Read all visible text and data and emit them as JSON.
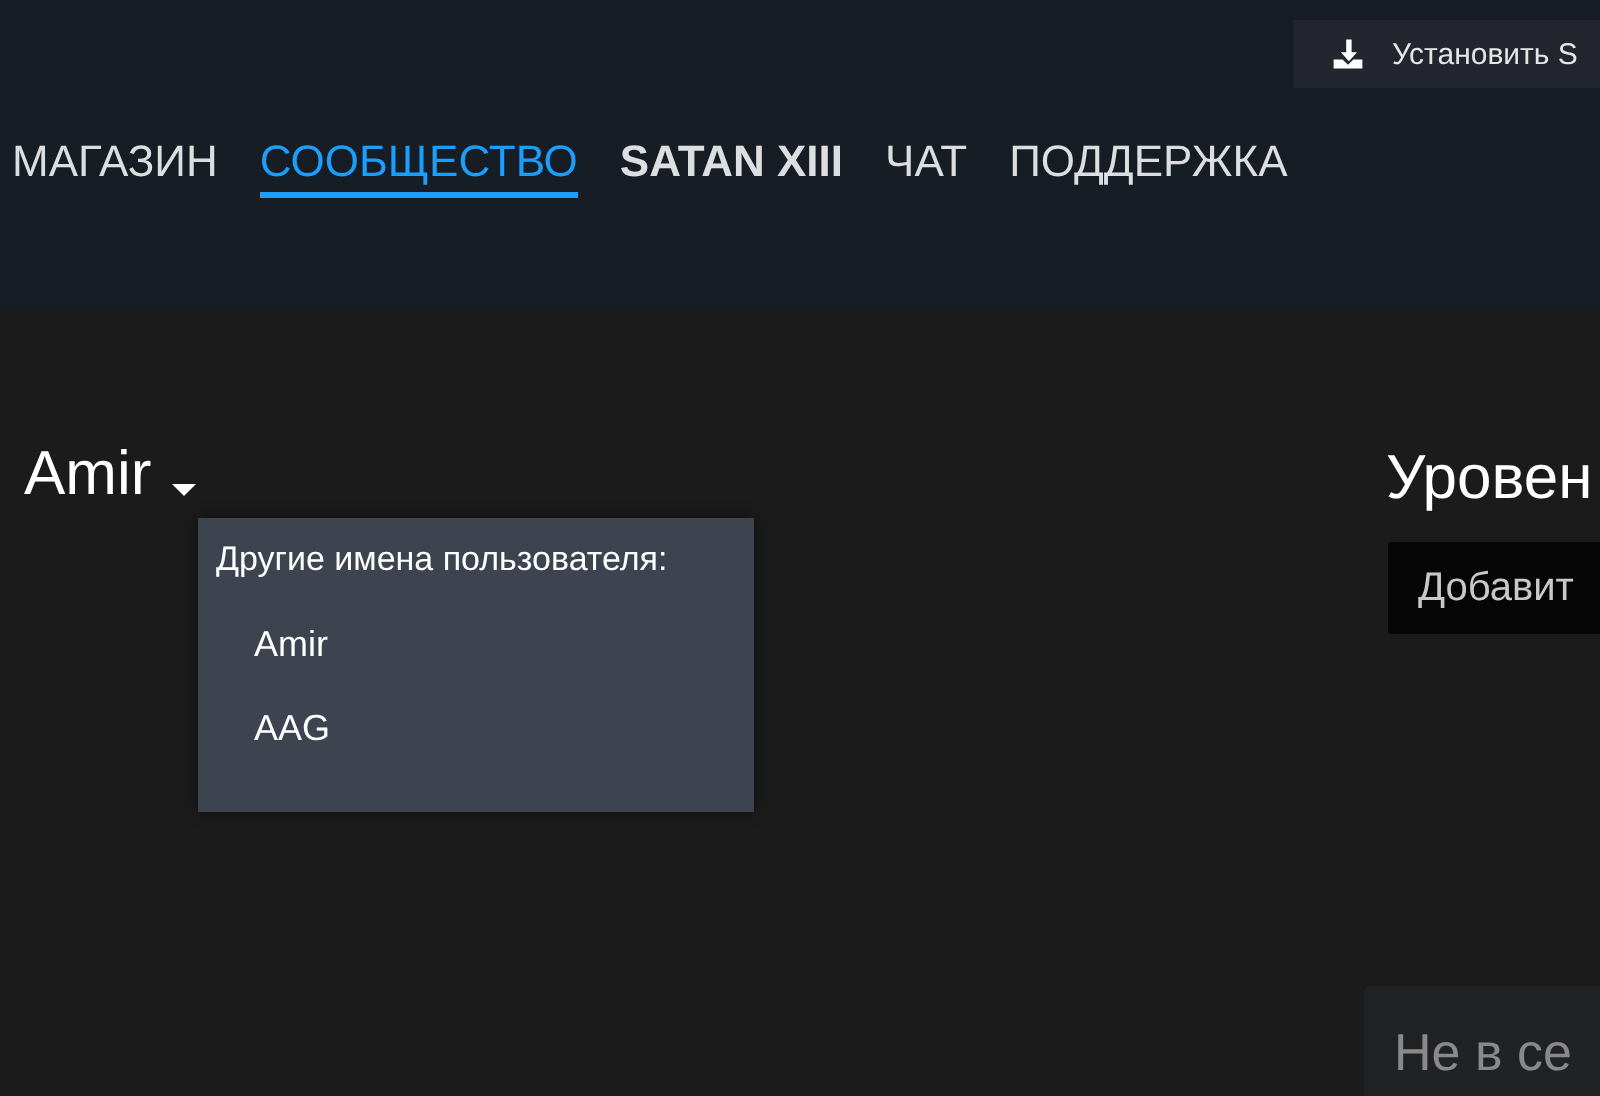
{
  "install_button": {
    "label": "Установить S"
  },
  "nav": [
    {
      "label": "МАГАЗИН",
      "kind": "link",
      "selected": false
    },
    {
      "label": "СООБЩЕСТВО",
      "kind": "link",
      "selected": true
    },
    {
      "label": "SATAN XIII",
      "kind": "profile",
      "selected": false
    },
    {
      "label": "ЧАТ",
      "kind": "link",
      "selected": false
    },
    {
      "label": "ПОДДЕРЖКА",
      "kind": "link",
      "selected": false
    }
  ],
  "profile": {
    "name": "Amir",
    "expanded": true,
    "aliases_menu": {
      "title": "Другие имена пользователя:",
      "items": [
        "Amir",
        "AAG"
      ]
    }
  },
  "level_heading": "Уровен",
  "add_button": {
    "label": "Добавит"
  },
  "status_panel": {
    "text": "Не в се"
  }
}
